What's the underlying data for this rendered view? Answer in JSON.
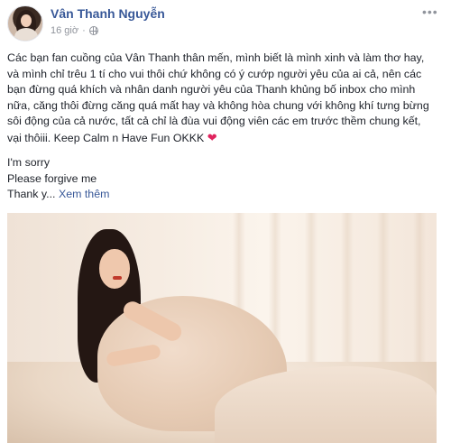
{
  "post": {
    "author": "Vân Thanh Nguyễn",
    "time": "16 giờ",
    "privacy_icon": "globe-icon",
    "menu_icon": "more-icon",
    "paragraph1": "Các bạn fan cuồng của Vân Thanh thân mến, mình biết là mình xinh và làm thơ hay, và mình chỉ trêu 1 tí cho vui thôi chứ không có ý cướp người yêu của ai cả, nên các bạn đừng quá khích và nhân danh người yêu của Thanh khủng bố inbox cho mình nữa, căng thôi đừng căng quá mất hay và không hòa chung với không khí tưng bừng sôi động của cả nước, tất cả chỉ là đùa vui động viên các em trước thềm chung kết, vại thôiii. Keep Calm n Have Fun OKKK",
    "heart": "❤",
    "line_sorry": "I'm sorry",
    "line_forgive": "Please forgive me",
    "line_thank": "Thank y...",
    "see_more": "Xem thêm"
  },
  "colors": {
    "author_link": "#385898",
    "meta_gray": "#90949c",
    "text": "#1d2129",
    "heart": "#e0245e"
  }
}
